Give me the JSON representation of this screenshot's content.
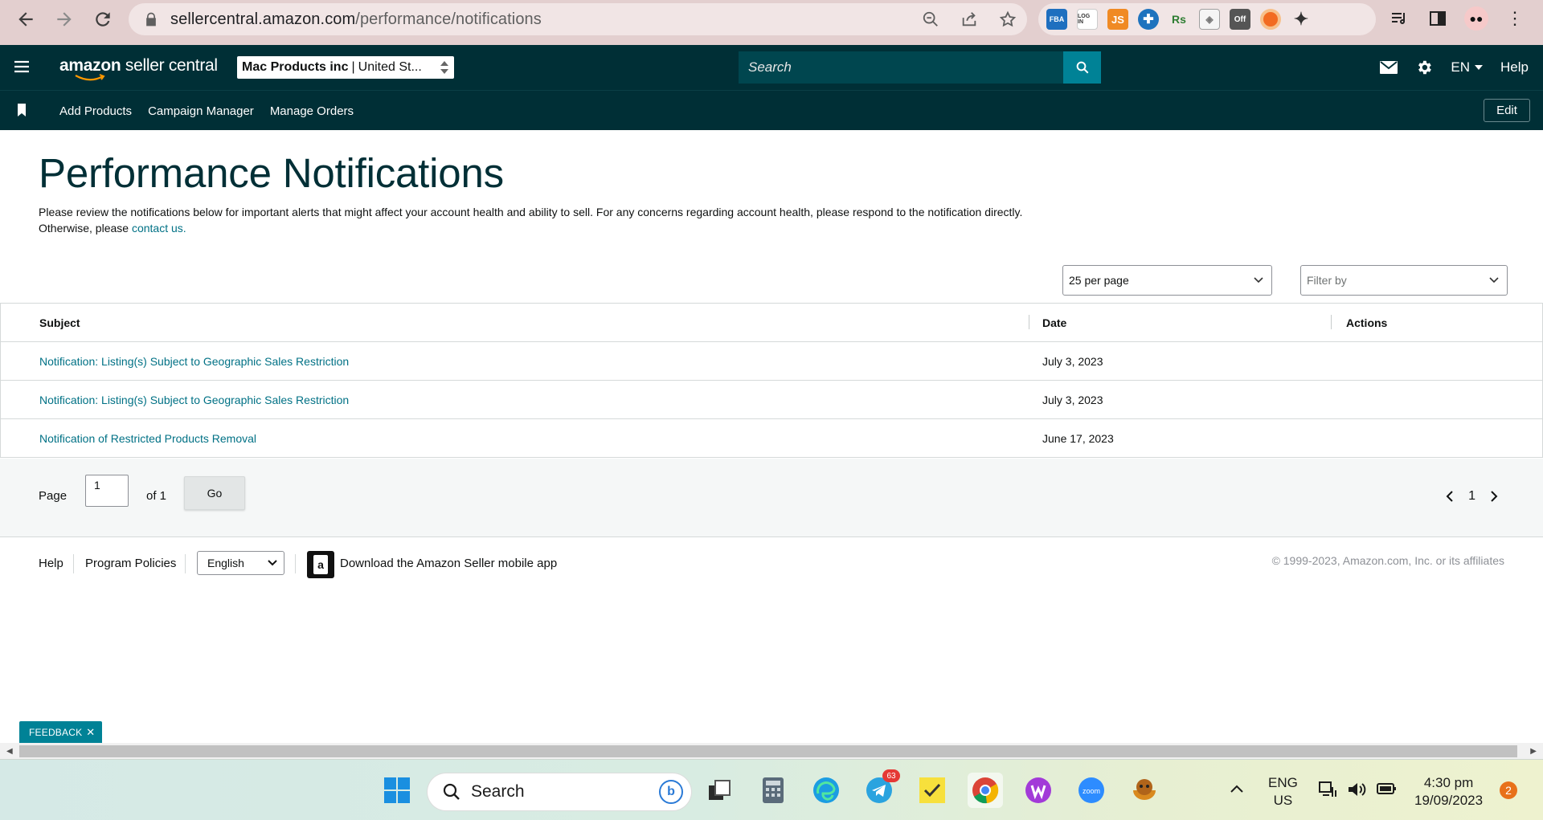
{
  "browser": {
    "url_domain": "sellercentral.amazon.com",
    "url_path": "/performance/notifications",
    "extensions": [
      {
        "name": "fba-extension-icon",
        "label": "FBA",
        "color": "#1f6fbf"
      },
      {
        "name": "login-extension-icon",
        "label": "LOG IN",
        "color": "#ffffff"
      },
      {
        "name": "js-extension-icon",
        "label": "JS",
        "color": "#f08a24"
      },
      {
        "name": "blue-plus-extension-icon",
        "label": "",
        "color": "#1e73be"
      },
      {
        "name": "rs-extension-icon",
        "label": "Rs",
        "color": "#2e7d32"
      },
      {
        "name": "box-extension-icon",
        "label": "",
        "color": "#a0a0a0"
      },
      {
        "name": "toggle-off-extension-icon",
        "label": "Off",
        "color": "#555555"
      },
      {
        "name": "orange-circle-extension-icon",
        "label": "",
        "color": "#f26b21"
      }
    ]
  },
  "header": {
    "logo_bold": "amazon",
    "logo_rest": " seller central",
    "store_name": "Mac Products inc",
    "store_region": "United St...",
    "search_placeholder": "Search",
    "language": "EN",
    "help": "Help"
  },
  "subnav": {
    "items": [
      "Add Products",
      "Campaign Manager",
      "Manage Orders"
    ],
    "edit": "Edit"
  },
  "main": {
    "title": "Performance Notifications",
    "intro_text": "Please review the notifications below for important alerts that might affect your account health and ability to sell. For any concerns regarding account health, please respond to the notification directly. Otherwise, please ",
    "intro_link": "contact us.",
    "per_page": "25 per page",
    "filter_placeholder": "Filter by"
  },
  "table": {
    "headers": {
      "subject": "Subject",
      "date": "Date",
      "actions": "Actions"
    },
    "rows": [
      {
        "subject": "Notification: Listing(s) Subject to Geographic Sales Restriction",
        "date": "July 3, 2023",
        "actions": ""
      },
      {
        "subject": "Notification: Listing(s) Subject to Geographic Sales Restriction",
        "date": "July 3, 2023",
        "actions": ""
      },
      {
        "subject": "Notification of Restricted Products Removal",
        "date": "June 17, 2023",
        "actions": ""
      }
    ]
  },
  "pagination": {
    "page_label": "Page",
    "page_value": "1",
    "of_label": "of 1",
    "go": "Go",
    "current": "1"
  },
  "footer": {
    "help": "Help",
    "policies": "Program Policies",
    "language": "English",
    "app_text": "Download the Amazon Seller mobile app",
    "copyright": "© 1999-2023, Amazon.com, Inc. or its affiliates"
  },
  "feedback": "FEEDBACK",
  "taskbar": {
    "search": "Search",
    "telegram_badge": "63",
    "lang_line1": "ENG",
    "lang_line2": "US",
    "time": "4:30 pm",
    "date": "19/09/2023",
    "notif_count": "2"
  },
  "colors": {
    "header_bg": "#002f36",
    "link": "#007185",
    "accent": "#008296"
  }
}
